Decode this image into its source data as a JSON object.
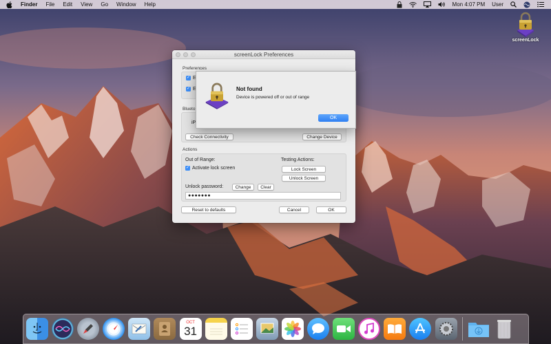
{
  "menubar": {
    "app_name": "Finder",
    "items": [
      "File",
      "Edit",
      "View",
      "Go",
      "Window",
      "Help"
    ],
    "clock": "Mon 4:07 PM",
    "user": "User"
  },
  "desktop": {
    "icon_label": "screenLock"
  },
  "prefs_window": {
    "title": "screenLock Preferences",
    "preferences_label": "Preferences",
    "pref_check_1": "E",
    "pref_check_2": "E",
    "bluetooth_label": "Blueto",
    "device_partial": "iP",
    "check_connectivity": "Check Connectivity",
    "change_device": "Change Device",
    "actions_label": "Actions",
    "out_of_range": "Out of Range:",
    "activate_lock": "Activate lock screen",
    "testing_actions": "Testing Actions:",
    "lock_screen": "Lock Screen",
    "unlock_screen": "Unlock Screen",
    "unlock_password_label": "Unlock password:",
    "change_btn": "Change",
    "clear_btn": "Clear",
    "password_value": "●●●●●●●",
    "reset_defaults": "Reset to defaults",
    "cancel": "Cancel",
    "ok": "OK"
  },
  "alert": {
    "title": "Not found",
    "message": "Device is powered off or out of range",
    "ok": "OK"
  },
  "calendar_icon": {
    "month": "OCT",
    "day": "31"
  },
  "dock": {
    "items": [
      "finder",
      "siri",
      "launchpad",
      "safari",
      "mail",
      "contacts",
      "calendar",
      "notes",
      "reminders",
      "photo-booth",
      "photos",
      "messages",
      "facetime",
      "itunes",
      "ibooks",
      "app-store",
      "system-preferences",
      "downloads",
      "trash"
    ]
  },
  "colors": {
    "accent": "#3d8ef7",
    "lock_purple": "#6b3fc4",
    "lock_gold": "#c9a233"
  }
}
